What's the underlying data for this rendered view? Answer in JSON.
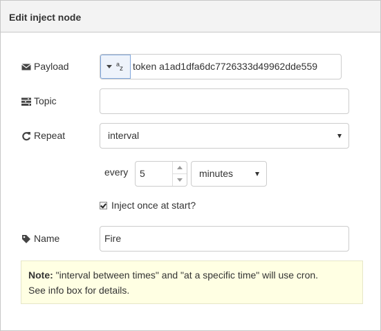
{
  "dialog": {
    "title": "Edit inject node"
  },
  "payload": {
    "label": "Payload",
    "value": "token a1ad1dfa6dc7726333d49962dde559"
  },
  "topic": {
    "label": "Topic",
    "value": ""
  },
  "repeat": {
    "label": "Repeat",
    "selected": "interval",
    "every_label": "every",
    "every_value": "5",
    "unit_selected": "minutes"
  },
  "inject_once": {
    "label": "Inject once at start?",
    "checked": true
  },
  "name": {
    "label": "Name",
    "value": "Fire"
  },
  "note": {
    "bold": "Note:",
    "text": " \"interval between times\" and \"at a specific time\" will use cron.",
    "text2": "See info box for details."
  }
}
